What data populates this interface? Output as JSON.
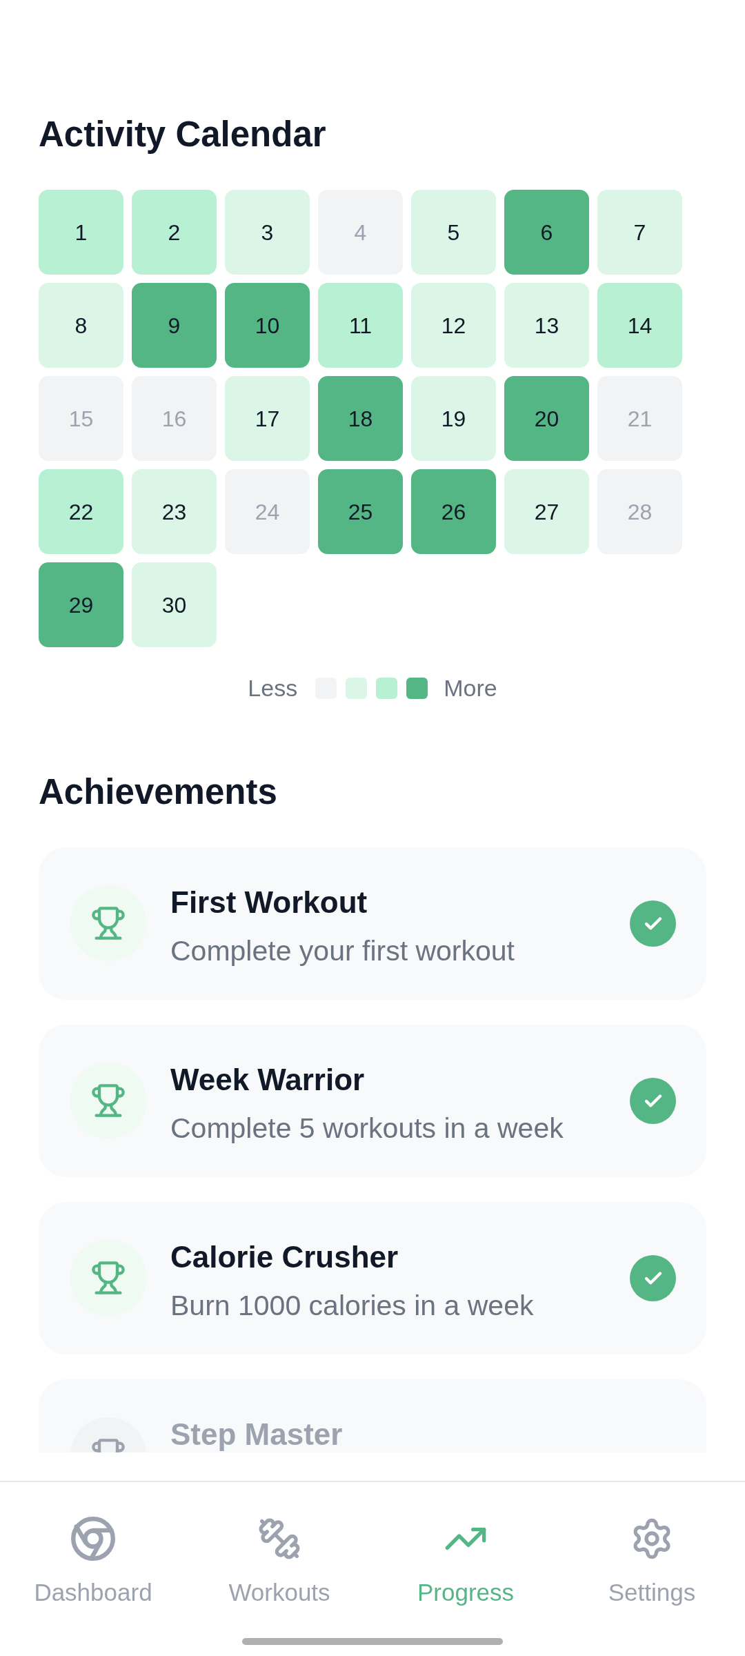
{
  "calendar": {
    "title": "Activity Calendar",
    "days": [
      {
        "label": "1",
        "color": "#b7f0d3",
        "active": true
      },
      {
        "label": "2",
        "color": "#b7f0d3",
        "active": true
      },
      {
        "label": "3",
        "color": "#dbf6e7",
        "active": true
      },
      {
        "label": "4",
        "color": "#f2f3f5",
        "active": false
      },
      {
        "label": "5",
        "color": "#dbf6e7",
        "active": true
      },
      {
        "label": "6",
        "color": "#55b685",
        "active": true
      },
      {
        "label": "7",
        "color": "#dbf6e7",
        "active": true
      },
      {
        "label": "8",
        "color": "#dbf6e7",
        "active": true
      },
      {
        "label": "9",
        "color": "#55b685",
        "active": true
      },
      {
        "label": "10",
        "color": "#55b685",
        "active": true
      },
      {
        "label": "11",
        "color": "#b7f0d3",
        "active": true
      },
      {
        "label": "12",
        "color": "#dbf6e7",
        "active": true
      },
      {
        "label": "13",
        "color": "#dbf6e7",
        "active": true
      },
      {
        "label": "14",
        "color": "#b7f0d3",
        "active": true
      },
      {
        "label": "15",
        "color": "#f2f3f5",
        "active": false
      },
      {
        "label": "16",
        "color": "#f2f3f5",
        "active": false
      },
      {
        "label": "17",
        "color": "#dbf6e7",
        "active": true
      },
      {
        "label": "18",
        "color": "#55b685",
        "active": true
      },
      {
        "label": "19",
        "color": "#dbf6e7",
        "active": true
      },
      {
        "label": "20",
        "color": "#55b685",
        "active": true
      },
      {
        "label": "21",
        "color": "#f2f3f5",
        "active": false
      },
      {
        "label": "22",
        "color": "#b7f0d3",
        "active": true
      },
      {
        "label": "23",
        "color": "#dbf6e7",
        "active": true
      },
      {
        "label": "24",
        "color": "#f2f3f5",
        "active": false
      },
      {
        "label": "25",
        "color": "#55b685",
        "active": true
      },
      {
        "label": "26",
        "color": "#55b685",
        "active": true
      },
      {
        "label": "27",
        "color": "#dbf6e7",
        "active": true
      },
      {
        "label": "28",
        "color": "#f2f3f5",
        "active": false
      },
      {
        "label": "29",
        "color": "#55b685",
        "active": true
      },
      {
        "label": "30",
        "color": "#dbf6e7",
        "active": true
      }
    ],
    "legend": {
      "less_label": "Less",
      "more_label": "More",
      "swatches": [
        {
          "color": "#f2f3f5"
        },
        {
          "color": "#dbf6e7"
        },
        {
          "color": "#b7f0d3"
        },
        {
          "color": "#55b685"
        }
      ]
    }
  },
  "achievements": {
    "title": "Achievements",
    "items": [
      {
        "title": "First Workout",
        "description": "Complete your first workout",
        "achieved": true
      },
      {
        "title": "Week Warrior",
        "description": "Complete 5 workouts in a week",
        "achieved": true
      },
      {
        "title": "Calorie Crusher",
        "description": "Burn 1000 calories in a week",
        "achieved": true
      },
      {
        "title": "Step Master",
        "achieved": false
      }
    ]
  },
  "nav": {
    "tabs": [
      {
        "label": "Dashboard",
        "selected": false
      },
      {
        "label": "Workouts",
        "selected": false
      },
      {
        "label": "Progress",
        "selected": true
      },
      {
        "label": "Settings",
        "selected": false
      }
    ]
  }
}
